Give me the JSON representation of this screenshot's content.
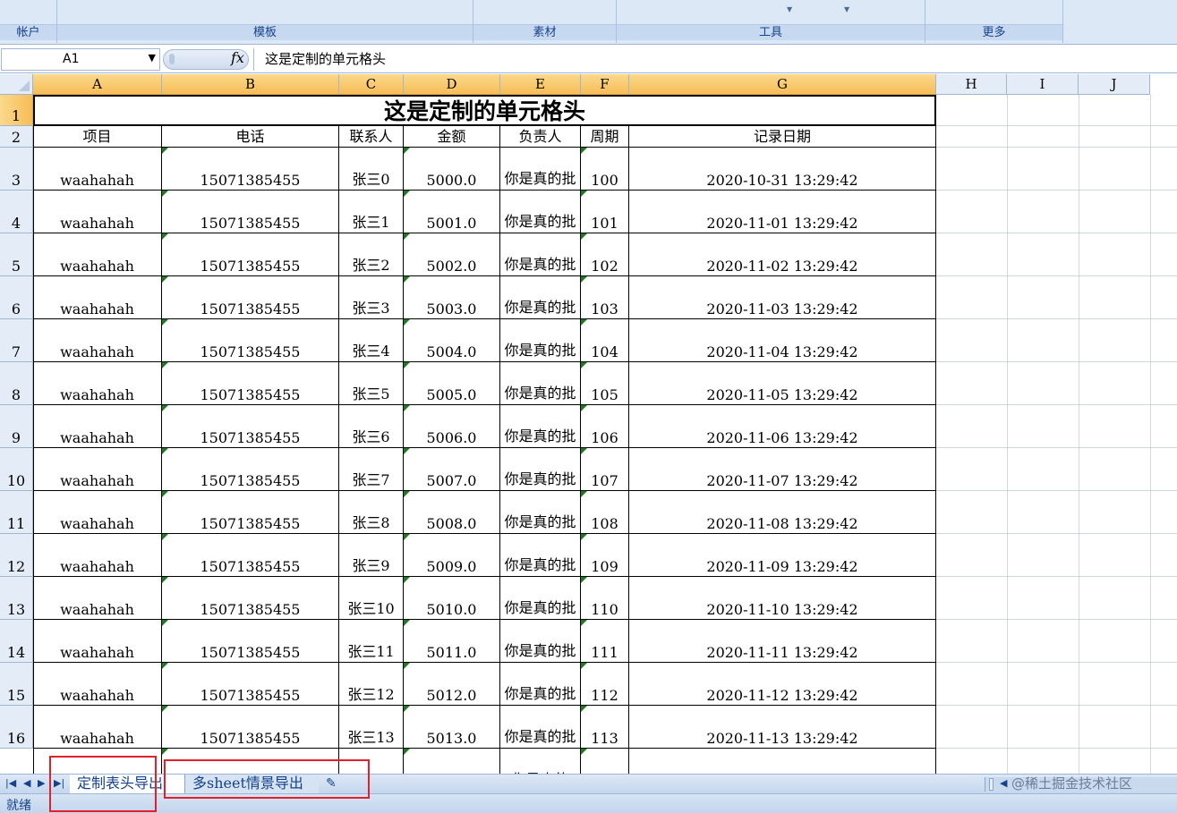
{
  "ribbon": {
    "groups": [
      "帐户",
      "模板",
      "素材",
      "工具",
      "更多"
    ]
  },
  "formula_bar": {
    "name_box": "A1",
    "fx": "fx",
    "formula": "这是定制的单元格头"
  },
  "columns": [
    "A",
    "B",
    "C",
    "D",
    "E",
    "F",
    "G",
    "H",
    "I",
    "J"
  ],
  "rows": [
    "1",
    "2",
    "3",
    "4",
    "5",
    "6",
    "7",
    "8",
    "9",
    "10",
    "11",
    "12",
    "13",
    "14",
    "15",
    "16"
  ],
  "sheet": {
    "title": "这是定制的单元格头",
    "headers": [
      "项目",
      "电话",
      "联系人",
      "金额",
      "负责人",
      "周期",
      "记录日期"
    ],
    "records": [
      [
        "waahahah",
        "15071385455",
        "张三0",
        "5000.0",
        "你是真的批",
        "100",
        "2020-10-31 13:29:42"
      ],
      [
        "waahahah",
        "15071385455",
        "张三1",
        "5001.0",
        "你是真的批",
        "101",
        "2020-11-01 13:29:42"
      ],
      [
        "waahahah",
        "15071385455",
        "张三2",
        "5002.0",
        "你是真的批",
        "102",
        "2020-11-02 13:29:42"
      ],
      [
        "waahahah",
        "15071385455",
        "张三3",
        "5003.0",
        "你是真的批",
        "103",
        "2020-11-03 13:29:42"
      ],
      [
        "waahahah",
        "15071385455",
        "张三4",
        "5004.0",
        "你是真的批",
        "104",
        "2020-11-04 13:29:42"
      ],
      [
        "waahahah",
        "15071385455",
        "张三5",
        "5005.0",
        "你是真的批",
        "105",
        "2020-11-05 13:29:42"
      ],
      [
        "waahahah",
        "15071385455",
        "张三6",
        "5006.0",
        "你是真的批",
        "106",
        "2020-11-06 13:29:42"
      ],
      [
        "waahahah",
        "15071385455",
        "张三7",
        "5007.0",
        "你是真的批",
        "107",
        "2020-11-07 13:29:42"
      ],
      [
        "waahahah",
        "15071385455",
        "张三8",
        "5008.0",
        "你是真的批",
        "108",
        "2020-11-08 13:29:42"
      ],
      [
        "waahahah",
        "15071385455",
        "张三9",
        "5009.0",
        "你是真的批",
        "109",
        "2020-11-09 13:29:42"
      ],
      [
        "waahahah",
        "15071385455",
        "张三10",
        "5010.0",
        "你是真的批",
        "110",
        "2020-11-10 13:29:42"
      ],
      [
        "waahahah",
        "15071385455",
        "张三11",
        "5011.0",
        "你是真的批",
        "111",
        "2020-11-11 13:29:42"
      ],
      [
        "waahahah",
        "15071385455",
        "张三12",
        "5012.0",
        "你是真的批",
        "112",
        "2020-11-12 13:29:42"
      ],
      [
        "waahahah",
        "15071385455",
        "张三13",
        "5013.0",
        "你是真的批",
        "113",
        "2020-11-13 13:29:42"
      ],
      [
        "",
        "",
        "",
        "",
        "你是真的",
        "",
        ""
      ]
    ]
  },
  "tabs": {
    "sheet1": "定制表头导出",
    "sheet2": "多sheet情景导出",
    "new_sheet_icon": "new-sheet-icon"
  },
  "watermark": "@稀土掘金技术社区",
  "status": "就绪",
  "colors": {
    "accent_selection": "#f7bd56",
    "header_bg": "#e4ecf7",
    "highlight_box": "#e0202a"
  }
}
